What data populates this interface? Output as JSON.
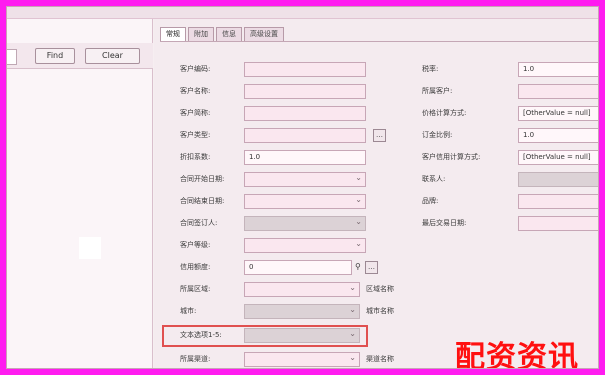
{
  "buttons": {
    "find": "Find",
    "clear": "Clear"
  },
  "tabs": [
    {
      "label": "常规",
      "active": true
    },
    {
      "label": "附加",
      "active": false
    },
    {
      "label": "信息",
      "active": false
    },
    {
      "label": "高级设置",
      "active": false
    }
  ],
  "left_form": [
    {
      "label": "客户编码:",
      "value": ""
    },
    {
      "label": "客户名称:",
      "value": ""
    },
    {
      "label": "客户简称:",
      "value": ""
    },
    {
      "label": "客户类型:",
      "value": ""
    },
    {
      "label": "折扣系数:",
      "value": "1.0"
    },
    {
      "label": "合同开始日期:",
      "value": ""
    },
    {
      "label": "合同结束日期:",
      "value": ""
    },
    {
      "label": "合同签订人:",
      "value": ""
    },
    {
      "label": "客户等级:",
      "value": ""
    },
    {
      "label": "信用额度:",
      "value": "0"
    },
    {
      "label": "所属区域:",
      "value": "",
      "extra": "区域名称"
    },
    {
      "label": "城市:",
      "value": "",
      "extra": "城市名称"
    },
    {
      "label": "文本选项1-5:",
      "value": ""
    },
    {
      "label": "所属渠道:",
      "value": "",
      "extra": "渠道名称"
    }
  ],
  "right_form": [
    {
      "label": "税率:",
      "value": "1.0"
    },
    {
      "label": "所属客户:",
      "value": ""
    },
    {
      "label": "价格计算方式:",
      "value": "[OtherValue = null]"
    },
    {
      "label": "订金比例:",
      "value": "1.0"
    },
    {
      "label": "客户信用计算方式:",
      "value": "[OtherValue = null]"
    },
    {
      "label": "联系人:",
      "value": ""
    },
    {
      "label": "品牌:",
      "value": ""
    },
    {
      "label": "最后交易日期:",
      "value": ""
    }
  ],
  "watermark": "配资资讯"
}
